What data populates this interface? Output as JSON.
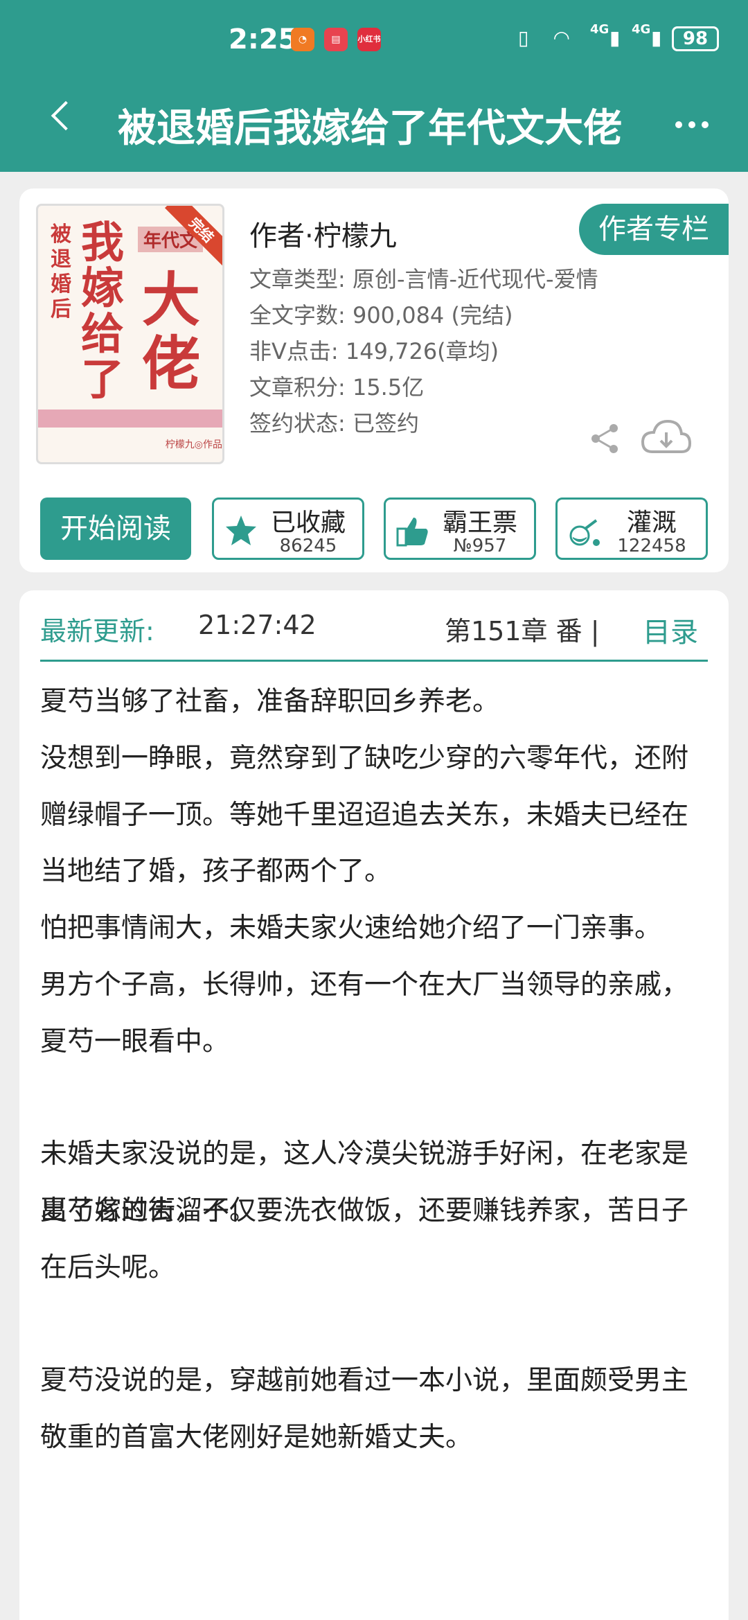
{
  "status_bar": {
    "time": "2:25",
    "signal1": "4G",
    "signal2": "4G",
    "battery": "98"
  },
  "header": {
    "title": "被退婚后我嫁给了年代文大佬",
    "back_icon": "chevron-left-icon",
    "more_icon": "more-dots-icon"
  },
  "colors": {
    "primary": "#2e9c8e",
    "cover_red": "#c93a3a"
  },
  "book": {
    "cover": {
      "vertical_small": "被退婚后",
      "vertical_big": "我嫁给了",
      "big2": "大佬",
      "tag": "年代文",
      "ribbon": "完结",
      "footer_author": "柠檬九◎作品"
    },
    "author": "作者·柠檬九",
    "author_column_label": "作者专栏",
    "meta": [
      "文章类型: 原创-言情-近代现代-爱情",
      "全文字数: 900,084 (完结)",
      "非Ⅴ点击: 149,726(章均)",
      "文章积分: 15.5亿",
      "签约状态: 已签约"
    ],
    "actions": {
      "read_label": "开始阅读",
      "collect": {
        "label": "已收藏",
        "count": "86245"
      },
      "vote": {
        "label": "霸王票",
        "count": "№957"
      },
      "irrigate": {
        "label": "灌溉",
        "count": "122458"
      }
    }
  },
  "content": {
    "latest_label": "最新更新:",
    "latest_time": "21:27:42",
    "latest_chapter": "第151章  番 |",
    "toc_label": "目录",
    "paragraphs": [
      "夏芍当够了社畜，准备辞职回乡养老。",
      "没想到一睁眼，竟然穿到了缺吃少穿的六零年代，还附赠绿帽子一顶。等她千里迢迢追去关东，未婚夫已经在当地结了婚，孩子都两个了。",
      "怕把事情闹大，未婚夫家火速给她介绍了一门亲事。",
      "男方个子高，长得帅，还有一个在大厂当领导的亲戚，夏芍一眼看中。",
      "未婚夫家没说的是，这人冷漠尖锐游手好闲，在老家是出了名的街溜子。",
      "夏芍嫁过去，不仅要洗衣做饭，还要赚钱养家，苦日子在后头呢。",
      "夏芍没说的是，穿越前她看过一本小说，里面颇受男主敬重的首富大佬刚好是她新婚丈夫。"
    ]
  }
}
